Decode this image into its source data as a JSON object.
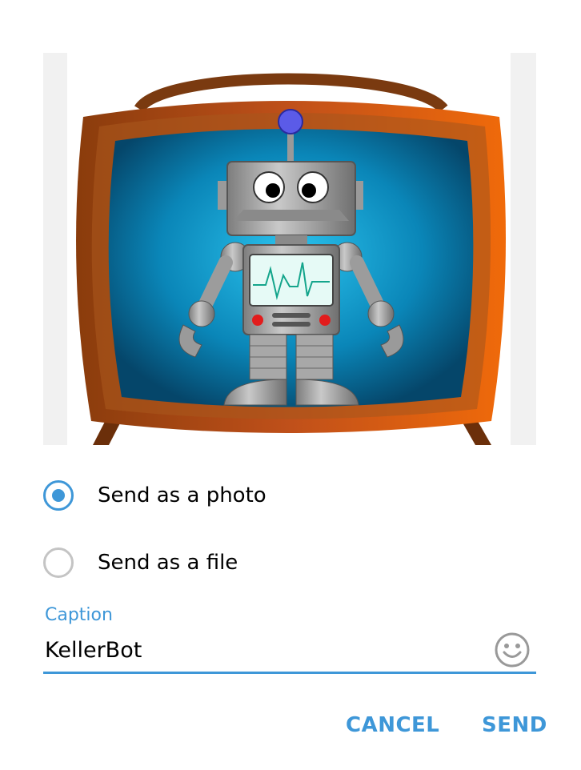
{
  "options": [
    {
      "label": "Send as a photo",
      "selected": true
    },
    {
      "label": "Send as a file",
      "selected": false
    }
  ],
  "caption": {
    "label": "Caption",
    "value": "KellerBot"
  },
  "actions": {
    "cancel": "CANCEL",
    "send": "SEND"
  },
  "colors": {
    "accent": "#3e97d8",
    "radio_off": "#c4c4c4"
  },
  "icons": {
    "emoji": "smiley-face-icon"
  }
}
